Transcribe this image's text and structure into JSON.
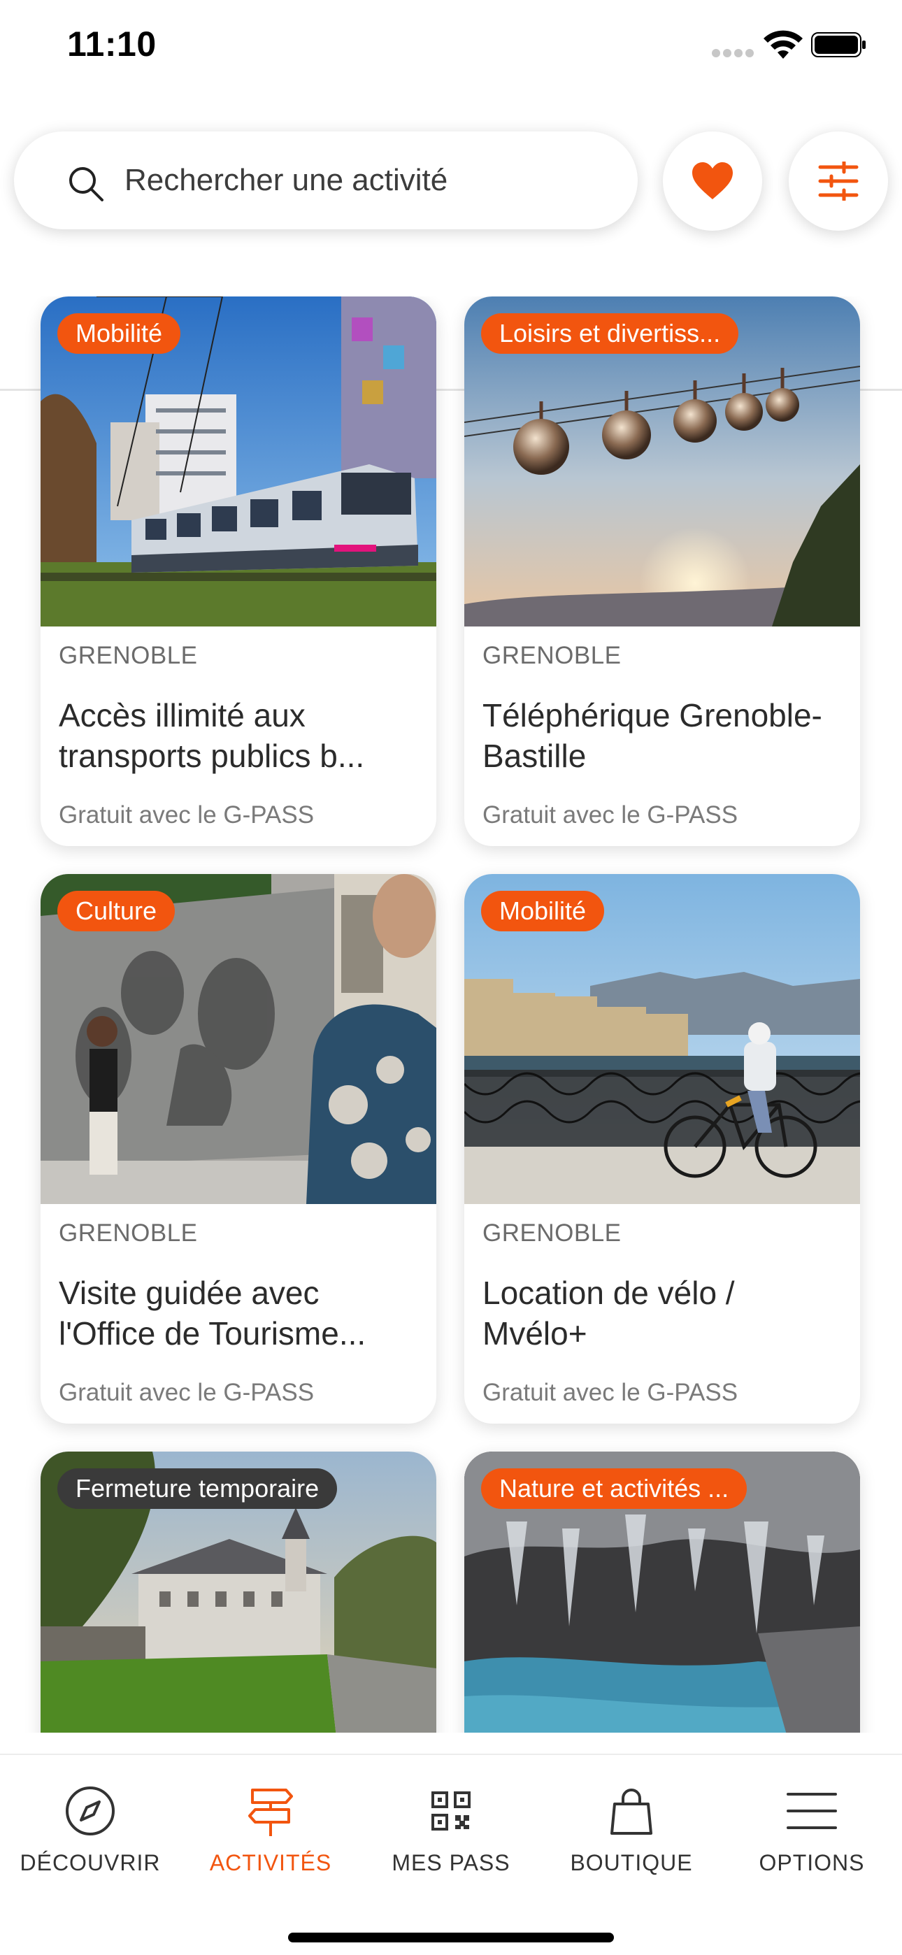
{
  "status_bar": {
    "time": "11:10"
  },
  "search": {
    "placeholder": "Rechercher une activité"
  },
  "colors": {
    "accent": "#f2550f",
    "badge_dark": "#3a3a3a"
  },
  "cards": [
    {
      "badge": "Mobilité",
      "city": "GRENOBLE",
      "title": "Accès illimité aux transports publics b...",
      "price": "Gratuit avec le G-PASS"
    },
    {
      "badge": "Loisirs et divertiss...",
      "city": "GRENOBLE",
      "title": "Téléphérique Grenoble-Bastille",
      "price": "Gratuit avec le G-PASS"
    },
    {
      "badge": "Culture",
      "city": "GRENOBLE",
      "title": "Visite guidée avec l'Office de Tourisme...",
      "price": "Gratuit avec le G-PASS"
    },
    {
      "badge": "Mobilité",
      "city": "GRENOBLE",
      "title": "Location de vélo / Mvélo+",
      "price": "Gratuit avec le G-PASS"
    },
    {
      "badge": "Fermeture temporaire"
    },
    {
      "badge": "Nature et activités ..."
    }
  ],
  "tabs": [
    {
      "label": "DÉCOUVRIR",
      "icon": "compass-icon"
    },
    {
      "label": "ACTIVITÉS",
      "icon": "signpost-icon"
    },
    {
      "label": "MES PASS",
      "icon": "qr-code-icon"
    },
    {
      "label": "BOUTIQUE",
      "icon": "shopping-bag-icon"
    },
    {
      "label": "OPTIONS",
      "icon": "menu-icon"
    }
  ]
}
